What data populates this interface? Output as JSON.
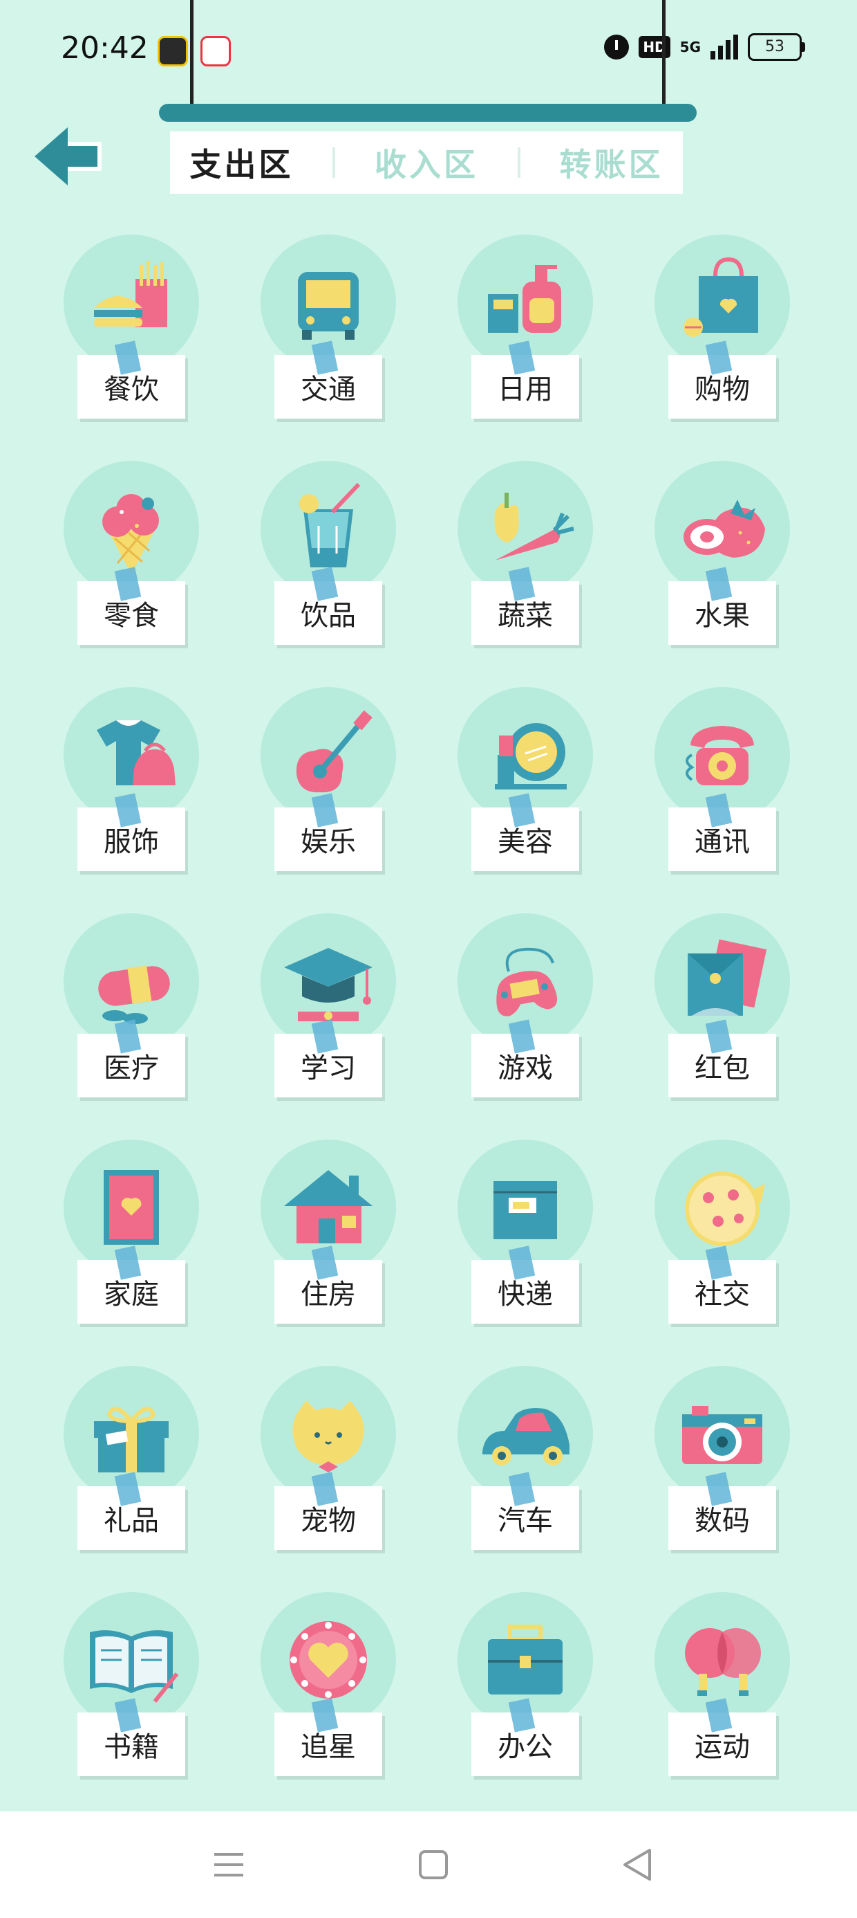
{
  "status_bar": {
    "time": "20:42",
    "network": "5G",
    "hd_label": "HD",
    "battery": "53"
  },
  "header": {
    "back_icon": "back-arrow-icon",
    "tabs": [
      {
        "label": "支出区",
        "active": true
      },
      {
        "label": "收入区",
        "active": false
      },
      {
        "label": "转账区",
        "active": false
      }
    ]
  },
  "colors": {
    "background": "#d3f5ea",
    "rail": "#2c8d96",
    "teal": "#3b9db3",
    "pink": "#f06b8a",
    "yellow": "#f5dc6e",
    "inactive_tab": "#a9ddd0"
  },
  "categories": [
    {
      "label": "餐饮",
      "icon": "food-icon"
    },
    {
      "label": "交通",
      "icon": "bus-icon"
    },
    {
      "label": "日用",
      "icon": "daily-goods-icon"
    },
    {
      "label": "购物",
      "icon": "shopping-bag-icon"
    },
    {
      "label": "零食",
      "icon": "ice-cream-icon"
    },
    {
      "label": "饮品",
      "icon": "drink-icon"
    },
    {
      "label": "蔬菜",
      "icon": "vegetable-icon"
    },
    {
      "label": "水果",
      "icon": "fruit-icon"
    },
    {
      "label": "服饰",
      "icon": "clothing-icon"
    },
    {
      "label": "娱乐",
      "icon": "guitar-icon"
    },
    {
      "label": "美容",
      "icon": "makeup-icon"
    },
    {
      "label": "通讯",
      "icon": "telephone-icon"
    },
    {
      "label": "医疗",
      "icon": "pill-icon"
    },
    {
      "label": "学习",
      "icon": "graduation-cap-icon"
    },
    {
      "label": "游戏",
      "icon": "gamepad-icon"
    },
    {
      "label": "红包",
      "icon": "red-envelope-icon"
    },
    {
      "label": "家庭",
      "icon": "family-frame-icon"
    },
    {
      "label": "住房",
      "icon": "house-icon"
    },
    {
      "label": "快递",
      "icon": "package-icon"
    },
    {
      "label": "社交",
      "icon": "pizza-icon"
    },
    {
      "label": "礼品",
      "icon": "gift-icon"
    },
    {
      "label": "宠物",
      "icon": "pet-cat-icon"
    },
    {
      "label": "汽车",
      "icon": "car-icon"
    },
    {
      "label": "数码",
      "icon": "camera-icon"
    },
    {
      "label": "书籍",
      "icon": "book-icon"
    },
    {
      "label": "追星",
      "icon": "heart-lightbox-icon"
    },
    {
      "label": "办公",
      "icon": "briefcase-icon"
    },
    {
      "label": "运动",
      "icon": "ping-pong-icon"
    }
  ],
  "nav": {
    "menu_icon": "menu-icon",
    "home_icon": "home-icon",
    "back_icon": "back-triangle-icon"
  }
}
